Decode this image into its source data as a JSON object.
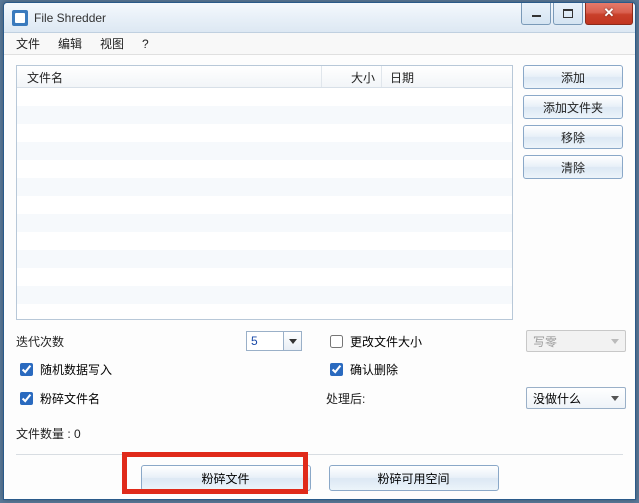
{
  "title": "File Shredder",
  "menu": {
    "file": "文件",
    "edit": "编辑",
    "view": "视图",
    "help": "?"
  },
  "columns": {
    "name": "文件名",
    "size": "大小",
    "date": "日期"
  },
  "side_buttons": {
    "add": "添加",
    "add_folder": "添加文件夹",
    "remove": "移除",
    "clear": "清除"
  },
  "options": {
    "iterations_label": "迭代次数",
    "iterations_value": "5",
    "change_size_label": "更改文件大小",
    "change_size_checked": false,
    "method_label": "写零",
    "random_write_label": "随机数据写入",
    "random_write_checked": true,
    "confirm_delete_label": "确认删除",
    "confirm_delete_checked": true,
    "shred_name_label": "粉碎文件名",
    "shred_name_checked": true,
    "after_label": "处理后:",
    "after_value": "没做什么"
  },
  "status": {
    "file_count_label": "文件数量 : 0"
  },
  "bottom": {
    "shred_files": "粉碎文件",
    "shred_freespace": "粉碎可用空间"
  }
}
